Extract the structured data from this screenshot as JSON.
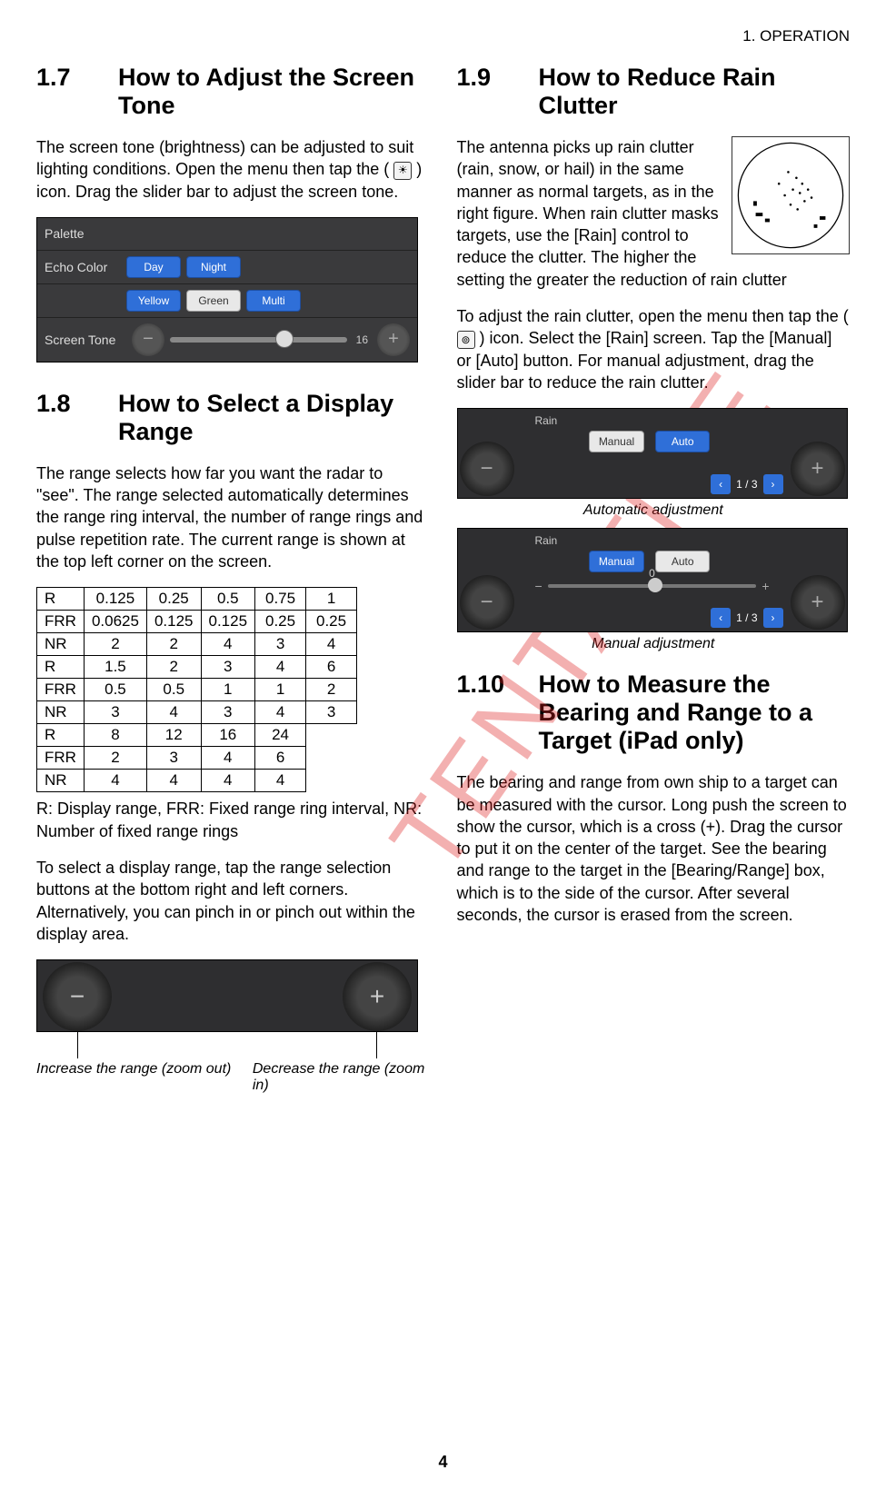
{
  "header": {
    "chapter": "1.  OPERATION"
  },
  "page_number": "4",
  "watermark": "TENTATIVE",
  "sec17": {
    "num": "1.7",
    "title": "How to Adjust the Screen Tone",
    "para1a": "The screen tone (brightness) can be adjusted to suit lighting conditions. Open the menu then tap the (",
    "para1b": ") icon. Drag the slider bar to adjust the screen tone.",
    "palette_label": "Palette",
    "echo_label": "Echo Color",
    "tone_label": "Screen Tone",
    "echo_opts": {
      "day": "Day",
      "night": "Night",
      "yellow": "Yellow",
      "green": "Green",
      "multi": "Multi"
    },
    "tone_value": "16"
  },
  "sec18": {
    "num": "1.8",
    "title": "How to Select a Display Range",
    "para1": "The range selects how far you want the radar to \"see\". The range selected automatically determines the range ring interval, the number of range rings and pulse repetition rate. The current range is shown at the top left corner on the screen.",
    "table": {
      "rows": [
        [
          "R",
          "0.125",
          "0.25",
          "0.5",
          "0.75",
          "1"
        ],
        [
          "FRR",
          "0.0625",
          "0.125",
          "0.125",
          "0.25",
          "0.25"
        ],
        [
          "NR",
          "2",
          "2",
          "4",
          "3",
          "4"
        ],
        [
          "R",
          "1.5",
          "2",
          "3",
          "4",
          "6"
        ],
        [
          "FRR",
          "0.5",
          "0.5",
          "1",
          "1",
          "2"
        ],
        [
          "NR",
          "3",
          "4",
          "3",
          "4",
          "3"
        ],
        [
          "R",
          "8",
          "12",
          "16",
          "24"
        ],
        [
          "FRR",
          "2",
          "3",
          "4",
          "6"
        ],
        [
          "NR",
          "4",
          "4",
          "4",
          "4"
        ]
      ]
    },
    "table_note": "R: Display range, FRR: Fixed range ring interval, NR: Number of fixed range rings",
    "para2": "To select a display range, tap the range selection buttons at the bottom right and left corners. Alternatively, you can pinch in or pinch out within the display area.",
    "caption_left": "Increase the range (zoom out)",
    "caption_right": "Decrease the range (zoom in)"
  },
  "sec19": {
    "num": "1.9",
    "title": "How to Reduce Rain Clutter",
    "para1": "The antenna picks up rain clutter (rain, snow, or hail) in the same manner as normal targets, as in the right figure. When rain clutter masks targets, use the [Rain] control to reduce the clutter. The higher the setting the greater the reduction of rain clutter",
    "para2a": "To adjust the rain clutter, open the menu then tap the (",
    "para2b": ") icon. Select the [Rain] screen. Tap the [Manual] or [Auto] button. For manual adjustment, drag the slider bar to reduce the rain clutter.",
    "rain_label": "Rain",
    "manual": "Manual",
    "auto": "Auto",
    "pager": "1 / 3",
    "slider_value": "0",
    "caption_auto": "Automatic adjustment",
    "caption_manual": "Manual adjustment"
  },
  "sec110": {
    "num": "1.10",
    "title": "How to Measure the Bearing and Range to a Target (iPad only)",
    "para1": "The bearing and range from own ship to a target can be measured with the cursor. Long push the screen to show the cursor, which is a cross (+). Drag the cursor to put it on the center of the target. See the bearing and range to the target in the [Bearing/Range] box, which is to the side of the cursor. After several seconds, the cursor is erased from the screen."
  }
}
